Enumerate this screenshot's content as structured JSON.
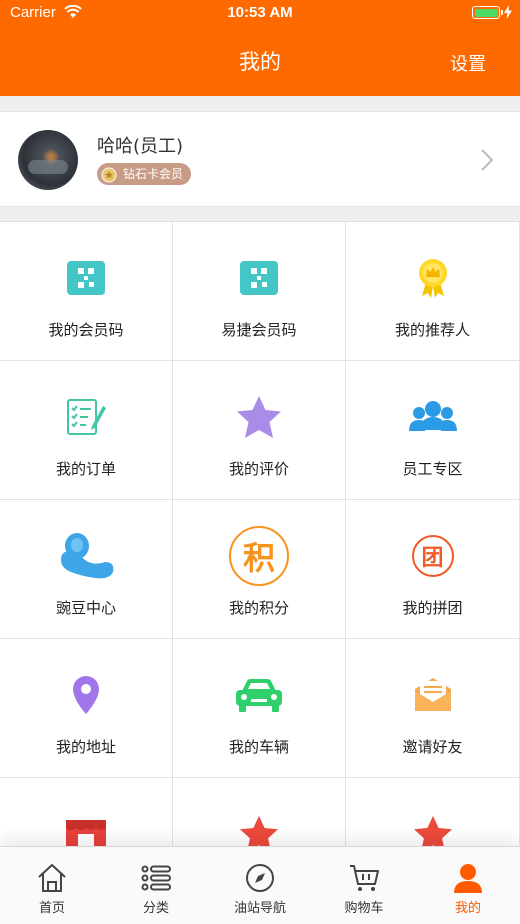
{
  "status": {
    "carrier": "Carrier",
    "time": "10:53 AM"
  },
  "nav": {
    "title": "我的",
    "settings": "设置"
  },
  "profile": {
    "name": "哈哈(员工)",
    "badge": "钻石卡会员"
  },
  "colors": {
    "accent": "#ff6a00",
    "tab_active": "#ff5a00",
    "teal": "#43c6c6"
  },
  "grid": [
    {
      "label": "我的会员码",
      "icon": "qr-code-icon"
    },
    {
      "label": "易捷会员码",
      "icon": "qr-code-icon"
    },
    {
      "label": "我的推荐人",
      "icon": "crown-badge-icon"
    },
    {
      "label": "我的订单",
      "icon": "order-list-icon"
    },
    {
      "label": "我的评价",
      "icon": "star-icon"
    },
    {
      "label": "员工专区",
      "icon": "people-group-icon"
    },
    {
      "label": "豌豆中心",
      "icon": "bean-icon"
    },
    {
      "label": "我的积分",
      "icon": "points-icon",
      "glyph": "积"
    },
    {
      "label": "我的拼团",
      "icon": "group-buy-icon",
      "glyph": "团"
    },
    {
      "label": "我的地址",
      "icon": "location-pin-icon"
    },
    {
      "label": "我的车辆",
      "icon": "car-icon"
    },
    {
      "label": "邀请好友",
      "icon": "invite-envelope-icon"
    },
    {
      "label": "",
      "icon": "store-icon"
    },
    {
      "label": "",
      "icon": "red-star-icon"
    },
    {
      "label": "",
      "icon": "red-star-icon"
    }
  ],
  "tabs": [
    {
      "label": "首页",
      "icon": "home-icon"
    },
    {
      "label": "分类",
      "icon": "category-list-icon"
    },
    {
      "label": "油站导航",
      "icon": "compass-icon"
    },
    {
      "label": "购物车",
      "icon": "cart-icon"
    },
    {
      "label": "我的",
      "icon": "user-icon",
      "active": true
    }
  ]
}
